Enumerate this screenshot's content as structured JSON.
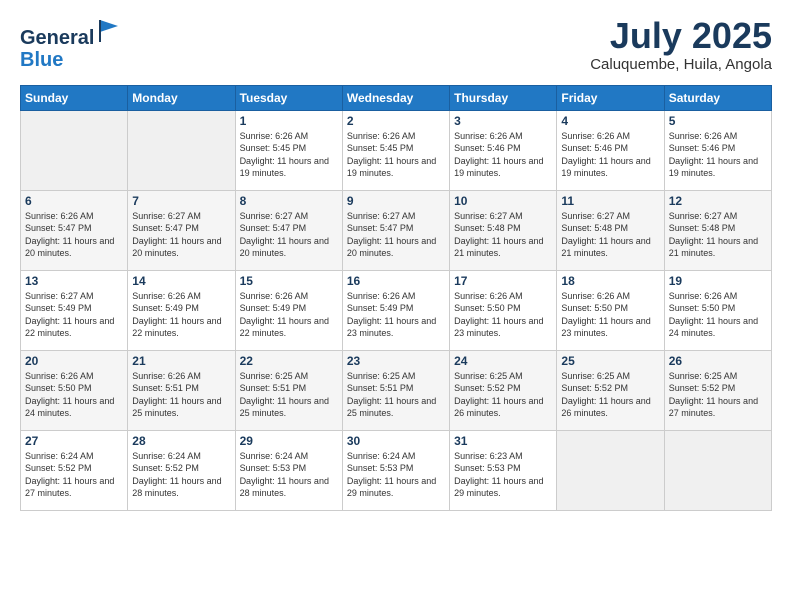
{
  "logo": {
    "general": "General",
    "blue": "Blue"
  },
  "header": {
    "title": "July 2025",
    "subtitle": "Caluquembe, Huila, Angola"
  },
  "weekdays": [
    "Sunday",
    "Monday",
    "Tuesday",
    "Wednesday",
    "Thursday",
    "Friday",
    "Saturday"
  ],
  "weeks": [
    [
      {
        "day": "",
        "info": ""
      },
      {
        "day": "",
        "info": ""
      },
      {
        "day": "1",
        "info": "Sunrise: 6:26 AM\nSunset: 5:45 PM\nDaylight: 11 hours and 19 minutes."
      },
      {
        "day": "2",
        "info": "Sunrise: 6:26 AM\nSunset: 5:45 PM\nDaylight: 11 hours and 19 minutes."
      },
      {
        "day": "3",
        "info": "Sunrise: 6:26 AM\nSunset: 5:46 PM\nDaylight: 11 hours and 19 minutes."
      },
      {
        "day": "4",
        "info": "Sunrise: 6:26 AM\nSunset: 5:46 PM\nDaylight: 11 hours and 19 minutes."
      },
      {
        "day": "5",
        "info": "Sunrise: 6:26 AM\nSunset: 5:46 PM\nDaylight: 11 hours and 19 minutes."
      }
    ],
    [
      {
        "day": "6",
        "info": "Sunrise: 6:26 AM\nSunset: 5:47 PM\nDaylight: 11 hours and 20 minutes."
      },
      {
        "day": "7",
        "info": "Sunrise: 6:27 AM\nSunset: 5:47 PM\nDaylight: 11 hours and 20 minutes."
      },
      {
        "day": "8",
        "info": "Sunrise: 6:27 AM\nSunset: 5:47 PM\nDaylight: 11 hours and 20 minutes."
      },
      {
        "day": "9",
        "info": "Sunrise: 6:27 AM\nSunset: 5:47 PM\nDaylight: 11 hours and 20 minutes."
      },
      {
        "day": "10",
        "info": "Sunrise: 6:27 AM\nSunset: 5:48 PM\nDaylight: 11 hours and 21 minutes."
      },
      {
        "day": "11",
        "info": "Sunrise: 6:27 AM\nSunset: 5:48 PM\nDaylight: 11 hours and 21 minutes."
      },
      {
        "day": "12",
        "info": "Sunrise: 6:27 AM\nSunset: 5:48 PM\nDaylight: 11 hours and 21 minutes."
      }
    ],
    [
      {
        "day": "13",
        "info": "Sunrise: 6:27 AM\nSunset: 5:49 PM\nDaylight: 11 hours and 22 minutes."
      },
      {
        "day": "14",
        "info": "Sunrise: 6:26 AM\nSunset: 5:49 PM\nDaylight: 11 hours and 22 minutes."
      },
      {
        "day": "15",
        "info": "Sunrise: 6:26 AM\nSunset: 5:49 PM\nDaylight: 11 hours and 22 minutes."
      },
      {
        "day": "16",
        "info": "Sunrise: 6:26 AM\nSunset: 5:49 PM\nDaylight: 11 hours and 23 minutes."
      },
      {
        "day": "17",
        "info": "Sunrise: 6:26 AM\nSunset: 5:50 PM\nDaylight: 11 hours and 23 minutes."
      },
      {
        "day": "18",
        "info": "Sunrise: 6:26 AM\nSunset: 5:50 PM\nDaylight: 11 hours and 23 minutes."
      },
      {
        "day": "19",
        "info": "Sunrise: 6:26 AM\nSunset: 5:50 PM\nDaylight: 11 hours and 24 minutes."
      }
    ],
    [
      {
        "day": "20",
        "info": "Sunrise: 6:26 AM\nSunset: 5:50 PM\nDaylight: 11 hours and 24 minutes."
      },
      {
        "day": "21",
        "info": "Sunrise: 6:26 AM\nSunset: 5:51 PM\nDaylight: 11 hours and 25 minutes."
      },
      {
        "day": "22",
        "info": "Sunrise: 6:25 AM\nSunset: 5:51 PM\nDaylight: 11 hours and 25 minutes."
      },
      {
        "day": "23",
        "info": "Sunrise: 6:25 AM\nSunset: 5:51 PM\nDaylight: 11 hours and 25 minutes."
      },
      {
        "day": "24",
        "info": "Sunrise: 6:25 AM\nSunset: 5:52 PM\nDaylight: 11 hours and 26 minutes."
      },
      {
        "day": "25",
        "info": "Sunrise: 6:25 AM\nSunset: 5:52 PM\nDaylight: 11 hours and 26 minutes."
      },
      {
        "day": "26",
        "info": "Sunrise: 6:25 AM\nSunset: 5:52 PM\nDaylight: 11 hours and 27 minutes."
      }
    ],
    [
      {
        "day": "27",
        "info": "Sunrise: 6:24 AM\nSunset: 5:52 PM\nDaylight: 11 hours and 27 minutes."
      },
      {
        "day": "28",
        "info": "Sunrise: 6:24 AM\nSunset: 5:52 PM\nDaylight: 11 hours and 28 minutes."
      },
      {
        "day": "29",
        "info": "Sunrise: 6:24 AM\nSunset: 5:53 PM\nDaylight: 11 hours and 28 minutes."
      },
      {
        "day": "30",
        "info": "Sunrise: 6:24 AM\nSunset: 5:53 PM\nDaylight: 11 hours and 29 minutes."
      },
      {
        "day": "31",
        "info": "Sunrise: 6:23 AM\nSunset: 5:53 PM\nDaylight: 11 hours and 29 minutes."
      },
      {
        "day": "",
        "info": ""
      },
      {
        "day": "",
        "info": ""
      }
    ]
  ]
}
